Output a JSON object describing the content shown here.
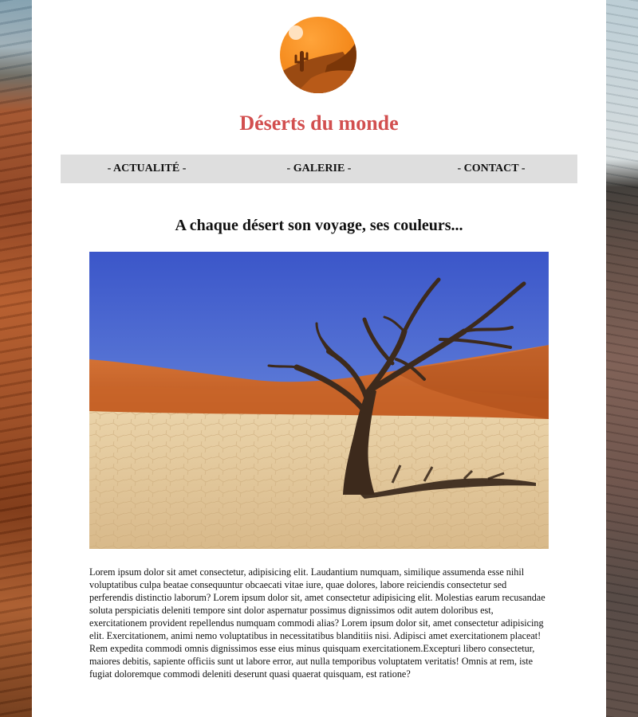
{
  "header": {
    "title": "Déserts du monde",
    "logo_icon": "desert-cactus-logo-icon"
  },
  "nav": {
    "items": [
      {
        "label": "- ACTUALITÉ -"
      },
      {
        "label": "- GALERIE -"
      },
      {
        "label": "- CONTACT -"
      }
    ]
  },
  "main": {
    "heading": "A chaque désert son voyage, ses couleurs...",
    "hero_icon": "dead-tree-desert-photo",
    "paragraph": "Lorem ipsum dolor sit amet consectetur, adipisicing elit. Laudantium numquam, similique assumenda esse nihil voluptatibus culpa beatae consequuntur obcaecati vitae iure, quae dolores, labore reiciendis consectetur sed perferendis distinctio laborum? Lorem ipsum dolor sit, amet consectetur adipisicing elit. Molestias earum recusandae soluta perspiciatis deleniti tempore sint dolor aspernatur possimus dignissimos odit autem doloribus est, exercitationem provident repellendus numquam commodi alias? Lorem ipsum dolor sit, amet consectetur adipisicing elit. Exercitationem, animi nemo voluptatibus in necessitatibus blanditiis nisi. Adipisci amet exercitationem placeat! Rem expedita commodi omnis dignissimos esse eius minus quisquam exercitationem.Excepturi libero consectetur, maiores debitis, sapiente officiis sunt ut labore error, aut nulla temporibus voluptatem veritatis! Omnis at rem, iste fugiat doloremque commodi deleniti deserunt quasi quaerat quisquam, est ratione?"
  },
  "colors": {
    "title": "#d24f4f",
    "nav_background": "#dedede",
    "logo_orange": "#f28a1c"
  }
}
